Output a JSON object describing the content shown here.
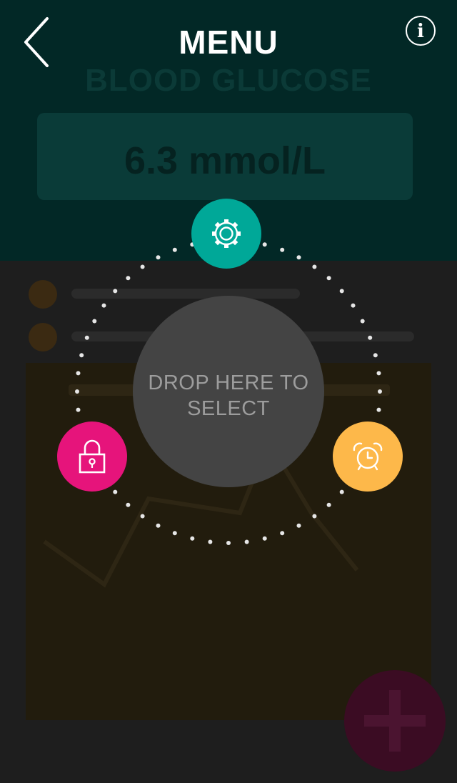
{
  "header": {
    "title": "MENU"
  },
  "radial_menu": {
    "drop_zone_line1": "DROP HERE TO",
    "drop_zone_line2": "SELECT",
    "items": [
      {
        "icon": "gear-icon",
        "color": "#00a898"
      },
      {
        "icon": "lock-icon",
        "color": "#e6147b"
      },
      {
        "icon": "alarm-clock-icon",
        "color": "#fdb84a"
      }
    ]
  },
  "background_app": {
    "title": "BLOOD GLUCOSE",
    "reading": "6.3 mmol/L"
  },
  "colors": {
    "accent_teal": "#00a898",
    "accent_pink": "#e6147b",
    "accent_orange": "#fdb84a",
    "drop_zone": "#444444"
  }
}
